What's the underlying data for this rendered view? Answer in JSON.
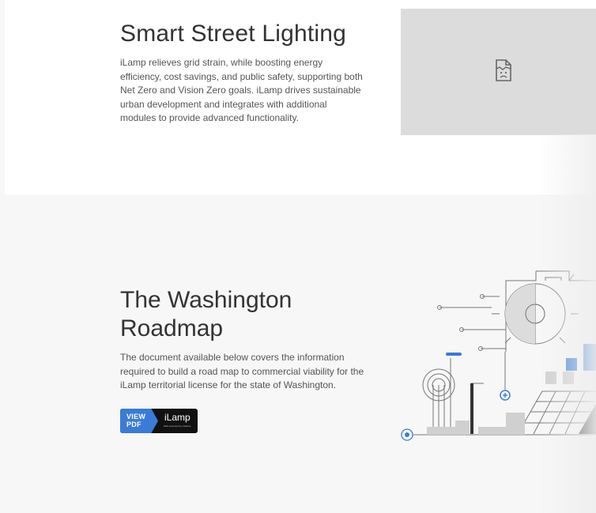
{
  "section_lighting": {
    "title": "Smart Street Lighting",
    "body": "iLamp relieves grid strain, while boosting energy efficiency, cost savings, and public safety, supporting both Net Zero and Vision Zero goals. iLamp drives sustainable urban development and integrates with additional modules to provide advanced functionality.",
    "image_icon": "broken-image-icon"
  },
  "section_roadmap": {
    "title": "The Washington Roadmap",
    "body": "The document available below covers the information required to build a road map to commercial viability for the iLamp territorial license for the state of Washington.",
    "pdf_button": {
      "view_label": "VIEW",
      "pdf_label": "PDF",
      "brand": "iLamp",
      "brand_sub": "Well-Licensed by Caslime"
    },
    "illustration": "smart-city-line-art"
  },
  "colors": {
    "accent_blue": "#3a7bd5",
    "heading": "#333333",
    "body_text": "#555555",
    "placeholder_bg": "#dcdcdc",
    "section_bg": "#f7f7f7"
  }
}
